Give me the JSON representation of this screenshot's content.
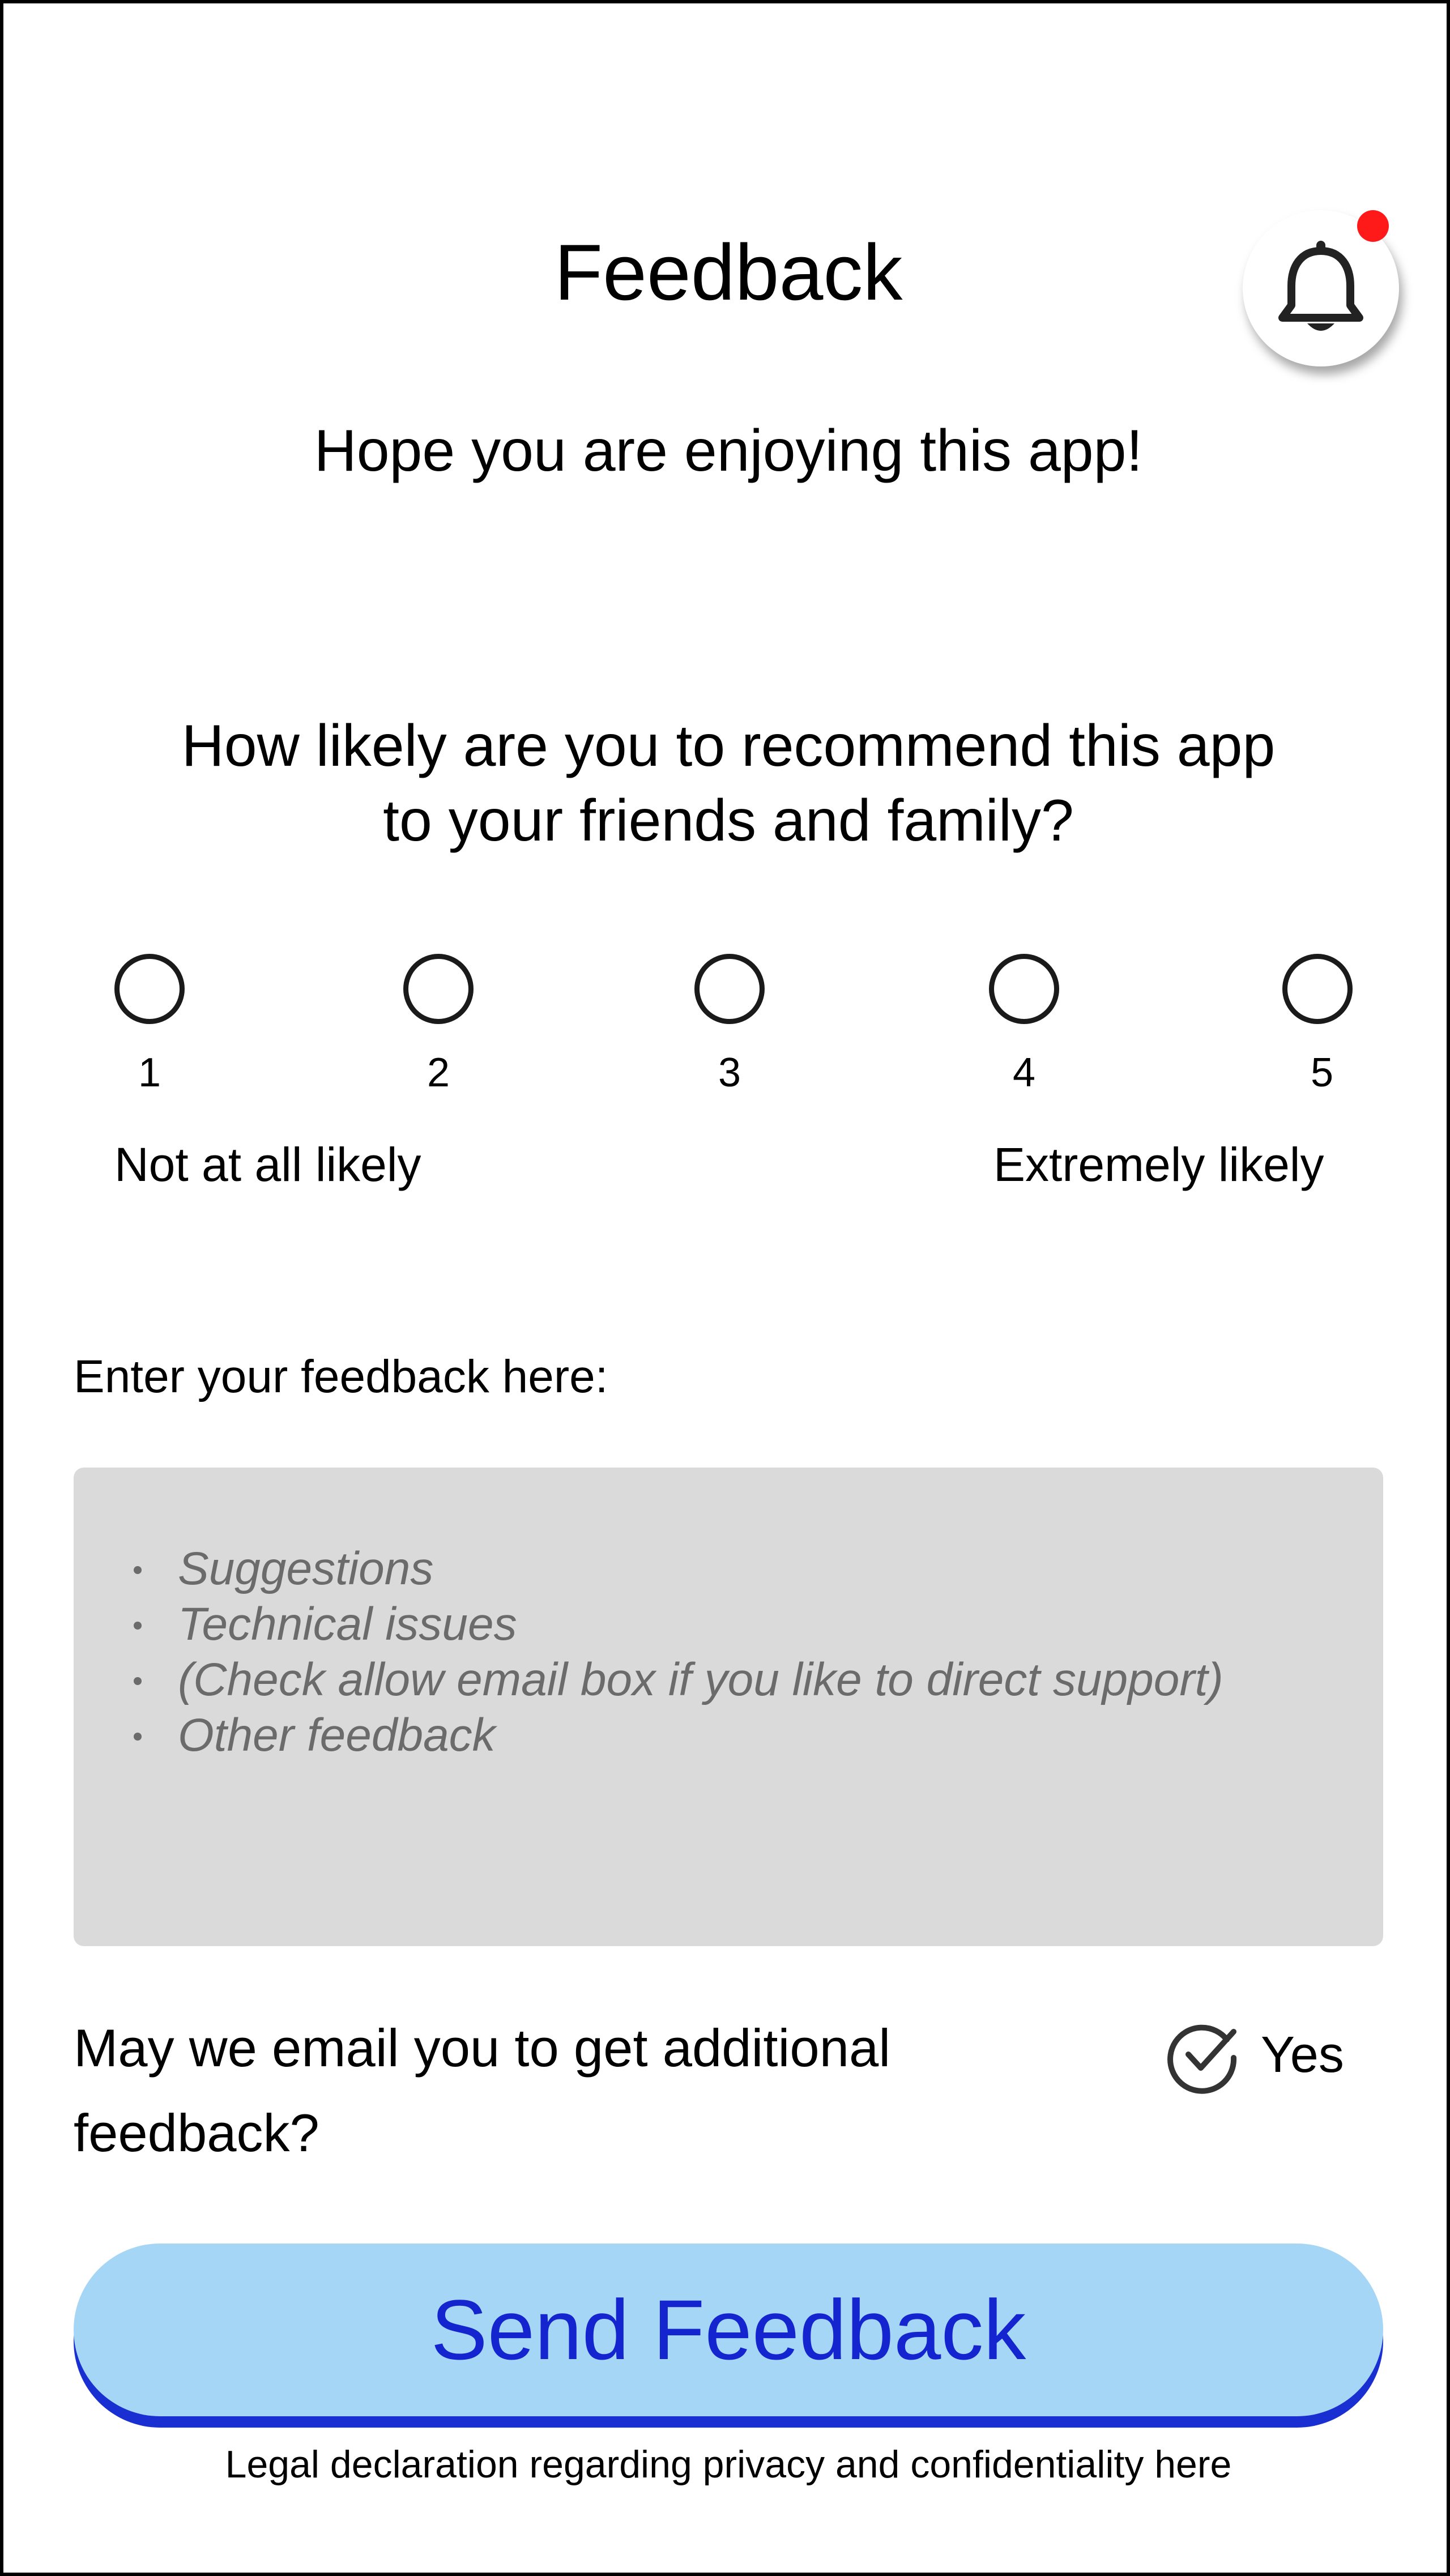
{
  "header": {
    "title": "Feedback",
    "notification_icon": "bell-icon",
    "notification_badge_color": "#ff1a1a"
  },
  "subtitle": "Hope you are enjoying this app!",
  "question": {
    "line1": "How likely are you to recommend this app",
    "line2": "to your friends and family?"
  },
  "rating": {
    "options": [
      "1",
      "2",
      "3",
      "4",
      "5"
    ],
    "selected": null,
    "low_label": "Not at all likely",
    "high_label": "Extremely likely"
  },
  "feedback": {
    "label": "Enter your feedback here:",
    "placeholder_items": [
      "Suggestions",
      "Technical issues",
      "(Check allow email box if you like to direct support)",
      "Other feedback"
    ],
    "background_color": "#dadada"
  },
  "email_consent": {
    "question": "May we email you to get additional feedback?",
    "option_label": "Yes",
    "checked": true,
    "icon": "check-circle-icon"
  },
  "submit": {
    "label": "Send Feedback",
    "background_color": "#a6d6f6",
    "text_color": "#1425d0"
  },
  "legal": "Legal declaration regarding privacy and confidentiality here"
}
